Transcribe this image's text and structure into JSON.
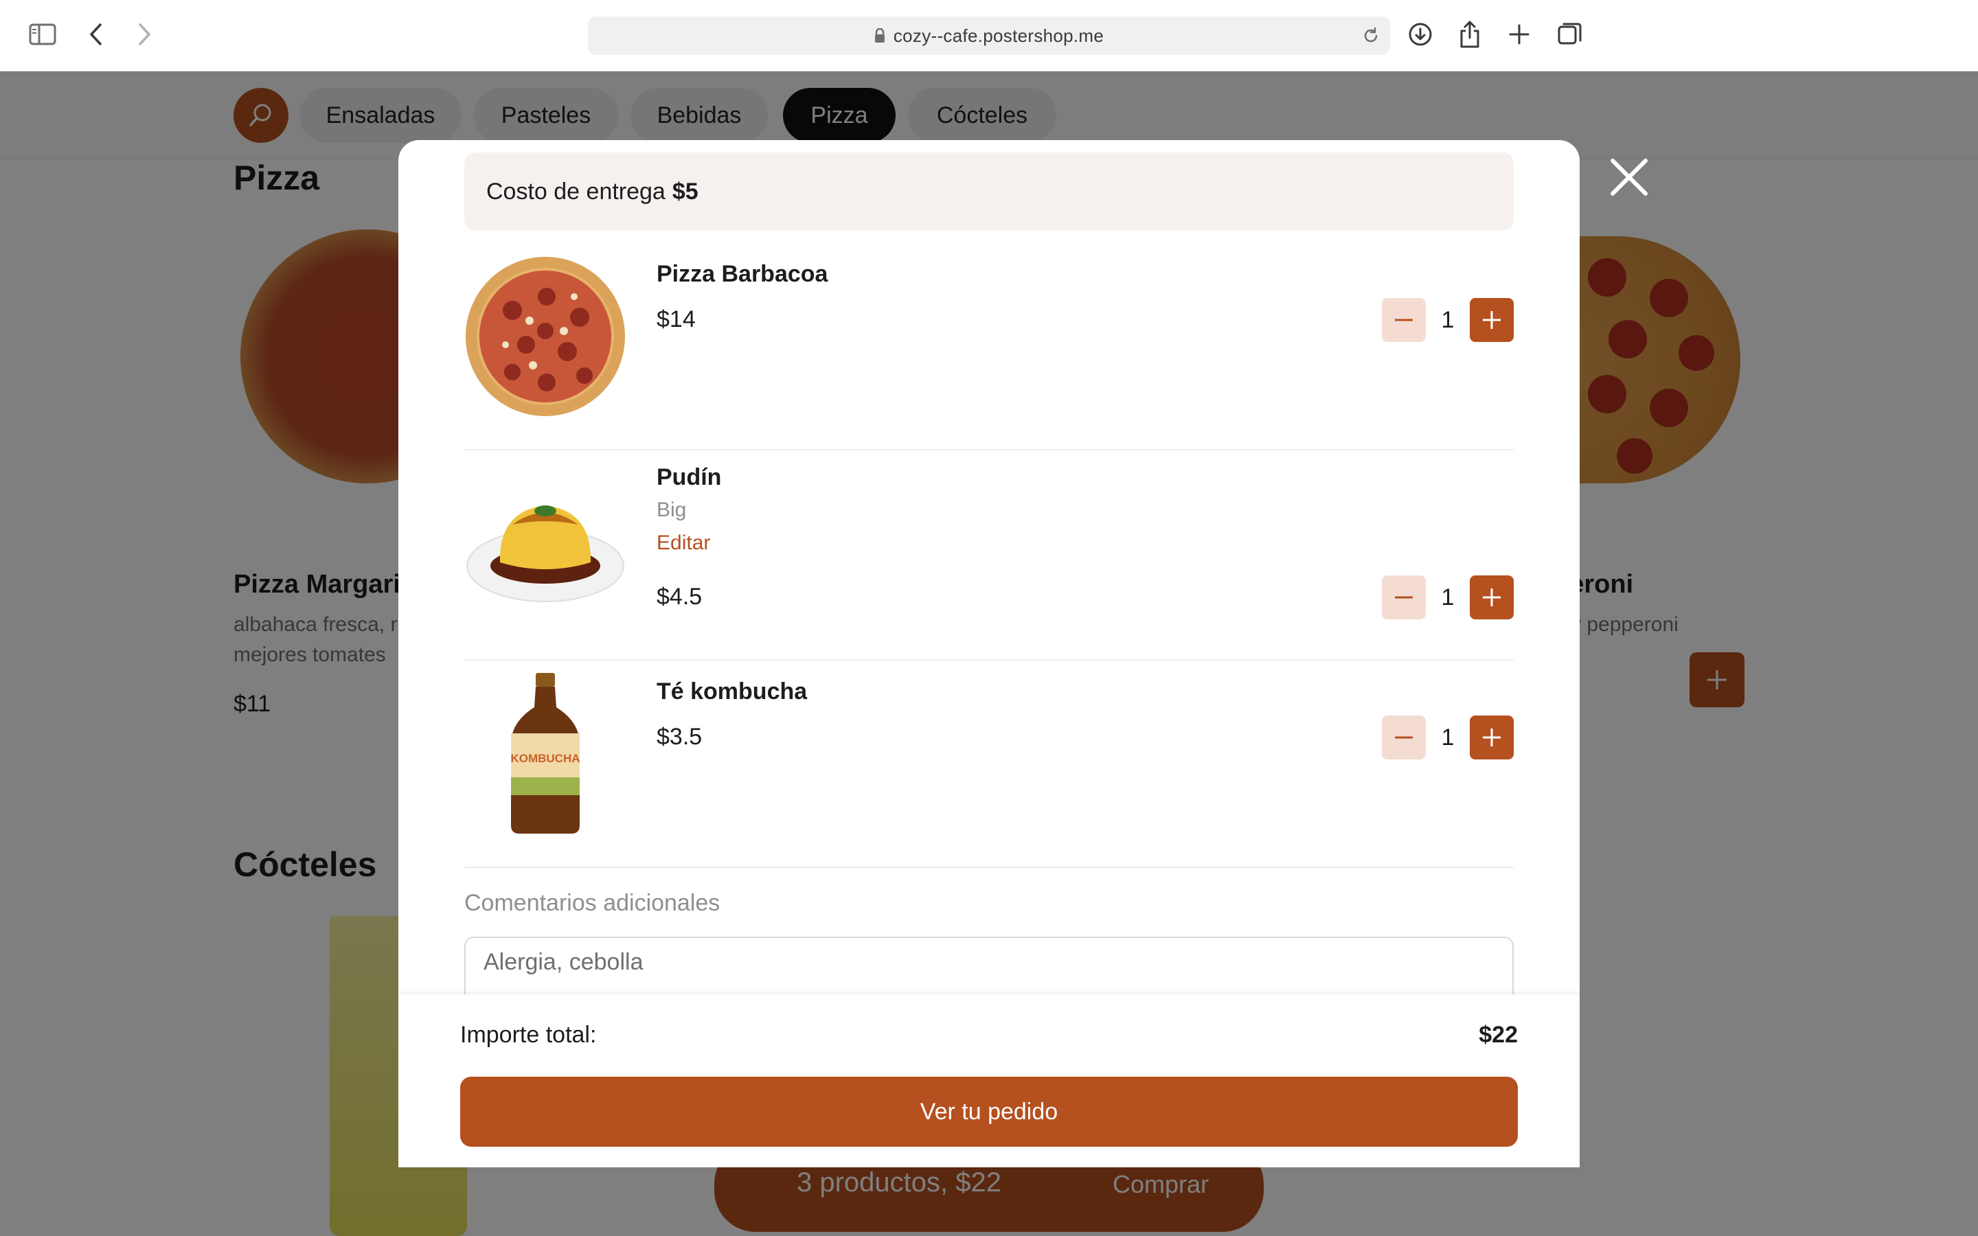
{
  "browser": {
    "url": "cozy--cafe.postershop.me",
    "icons": [
      "sidebar-icon",
      "back-icon",
      "forward-icon",
      "lock-icon",
      "reload-icon",
      "download-icon",
      "share-icon",
      "new-tab-icon",
      "tabs-overview-icon"
    ]
  },
  "categories": [
    {
      "label": "Ensaladas",
      "active": false
    },
    {
      "label": "Pasteles",
      "active": false
    },
    {
      "label": "Bebidas",
      "active": false
    },
    {
      "label": "Pizza",
      "active": true
    },
    {
      "label": "Cócteles",
      "active": false
    }
  ],
  "background": {
    "section_pizza": "Pizza",
    "section_cocteles": "Cócteles",
    "left_product": {
      "name": "Pizza Margari",
      "desc_line1": "albahaca fresca, r",
      "desc_line2": "mejores tomates",
      "price": "$11"
    },
    "right_product": {
      "name": "peroni",
      "desc": "o y pepperoni"
    },
    "cart_bar": {
      "text": "3 productos, $22",
      "action": "Comprar"
    }
  },
  "modal": {
    "delivery_label": "Costo de entrega",
    "delivery_value": "$5",
    "items": [
      {
        "name": "Pizza Barbacoa",
        "price": "$14",
        "qty": "1"
      },
      {
        "name": "Pudín",
        "option": "Big",
        "edit_label": "Editar",
        "price": "$4.5",
        "qty": "1"
      },
      {
        "name": "Té kombucha",
        "price": "$3.5",
        "qty": "1",
        "bottle_label": "KOMBUCHA"
      }
    ],
    "comments_label": "Comentarios adicionales",
    "comments_value": "Alergia, cebolla",
    "total_label": "Importe total:",
    "total_value": "$22",
    "cta_label": "Ver tu pedido"
  },
  "colors": {
    "accent": "#b5501f",
    "accent_light": "#f5dcd3",
    "delivery_bg": "#f6f1ef",
    "overlay": "rgba(0,0,0,0.5)"
  }
}
